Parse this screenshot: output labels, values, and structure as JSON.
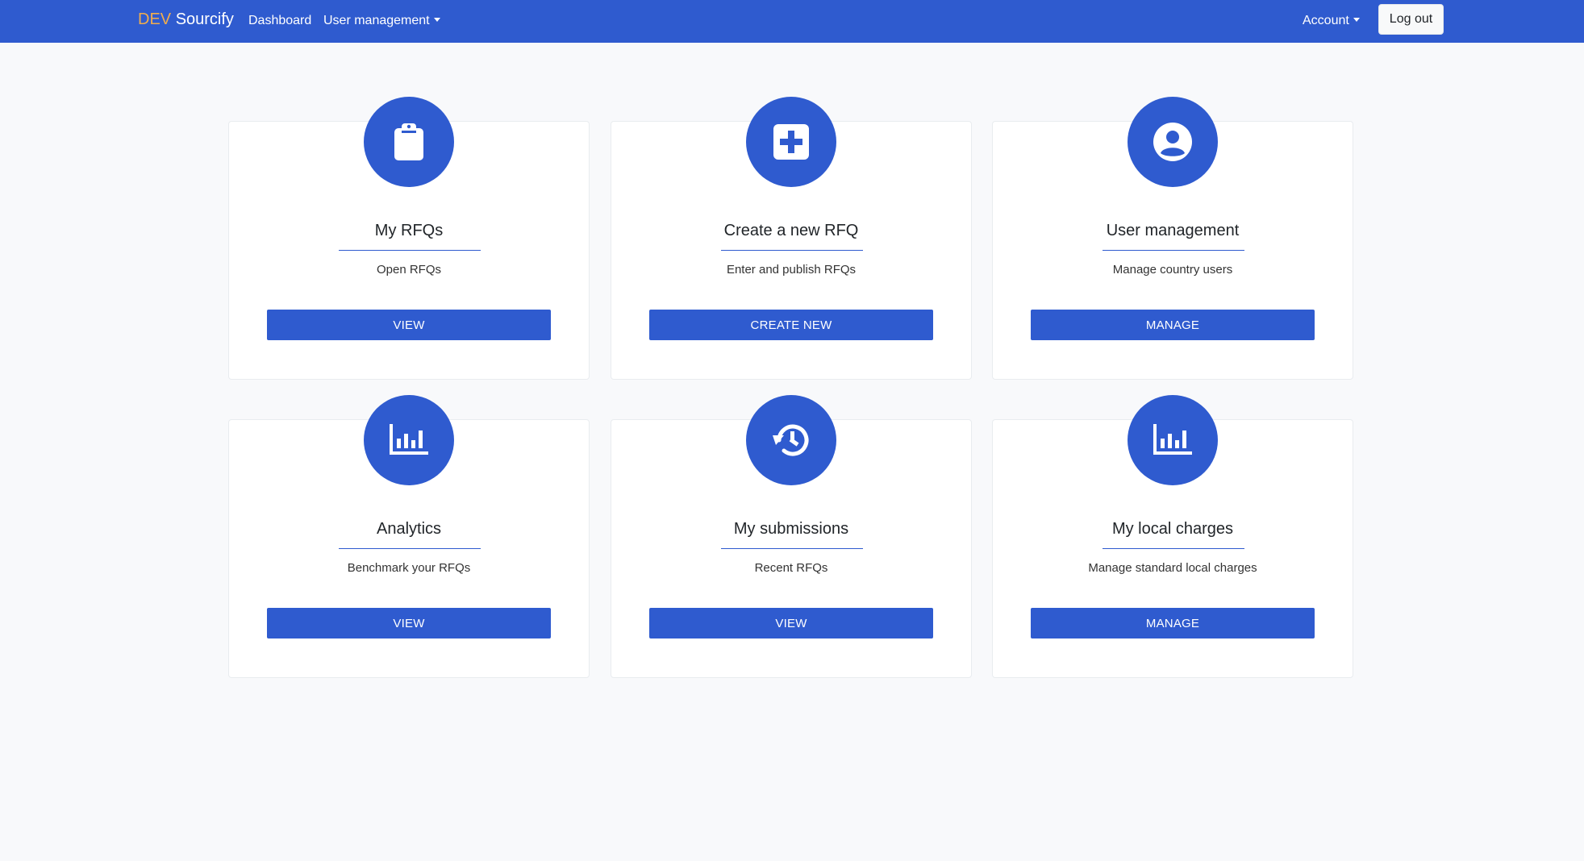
{
  "navbar": {
    "brand_prefix": "DEV",
    "brand_name": "Sourcify",
    "links": {
      "dashboard": "Dashboard",
      "user_management": "User management",
      "account": "Account"
    },
    "logout_label": "Log out"
  },
  "cards": [
    {
      "icon": "clipboard-icon",
      "title": "My RFQs",
      "subtitle": "Open RFQs",
      "button": "VIEW"
    },
    {
      "icon": "plus-square-icon",
      "title": "Create a new RFQ",
      "subtitle": "Enter and publish RFQs",
      "button": "CREATE NEW"
    },
    {
      "icon": "user-circle-icon",
      "title": "User management",
      "subtitle": "Manage country users",
      "button": "MANAGE"
    },
    {
      "icon": "bar-chart-icon",
      "title": "Analytics",
      "subtitle": "Benchmark your RFQs",
      "button": "VIEW"
    },
    {
      "icon": "history-icon",
      "title": "My submissions",
      "subtitle": "Recent RFQs",
      "button": "VIEW"
    },
    {
      "icon": "bar-chart-icon",
      "title": "My local charges",
      "subtitle": "Manage standard local charges",
      "button": "MANAGE"
    }
  ],
  "colors": {
    "primary": "#2f5bcf",
    "brand_prefix": "#f0ad4e",
    "background": "#f8f9fb"
  }
}
